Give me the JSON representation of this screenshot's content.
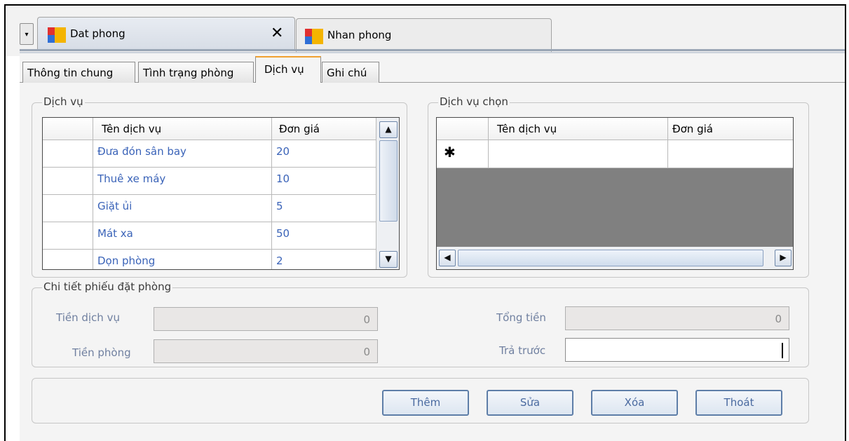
{
  "doc_tabs": [
    {
      "label": "Dat phong",
      "active": true
    },
    {
      "label": "Nhan phong",
      "active": false
    }
  ],
  "inner_tabs": [
    "Thông tin chung",
    "Tình trạng phòng",
    "Dịch vụ",
    "Ghi chú"
  ],
  "selected_inner_tab": "Dịch vụ",
  "services": {
    "legend": "Dịch vụ",
    "headers": [
      "Tên dịch vụ",
      "Đơn giá"
    ],
    "rows": [
      {
        "name": "Đưa đón sân bay",
        "price": "20"
      },
      {
        "name": "Thuê xe máy",
        "price": "10"
      },
      {
        "name": "Giặt ủi",
        "price": "5"
      },
      {
        "name": "Mát xa",
        "price": "50"
      },
      {
        "name": "Dọn phòng",
        "price": "2"
      }
    ]
  },
  "selected_services": {
    "legend": "Dịch vụ chọn",
    "headers": [
      "Tên dịch vụ",
      "Đơn giá"
    ],
    "new_row_marker": "✱"
  },
  "details": {
    "legend": "Chi tiết phiếu đặt phòng",
    "service_fee_label": "Tiền dịch vụ",
    "service_fee_value": "0",
    "room_fee_label": "Tiền phòng",
    "room_fee_value": "0",
    "total_label": "Tổng tiền",
    "total_value": "0",
    "prepaid_label": "Trả trước",
    "prepaid_value": ""
  },
  "buttons": {
    "add": "Thêm",
    "edit": "Sửa",
    "delete": "Xóa",
    "exit": "Thoát"
  },
  "icons": {
    "dropdown": "▾",
    "close": "✕",
    "scroll_up": "▲",
    "scroll_down": "▼",
    "scroll_left": "◀",
    "scroll_right": "▶"
  }
}
